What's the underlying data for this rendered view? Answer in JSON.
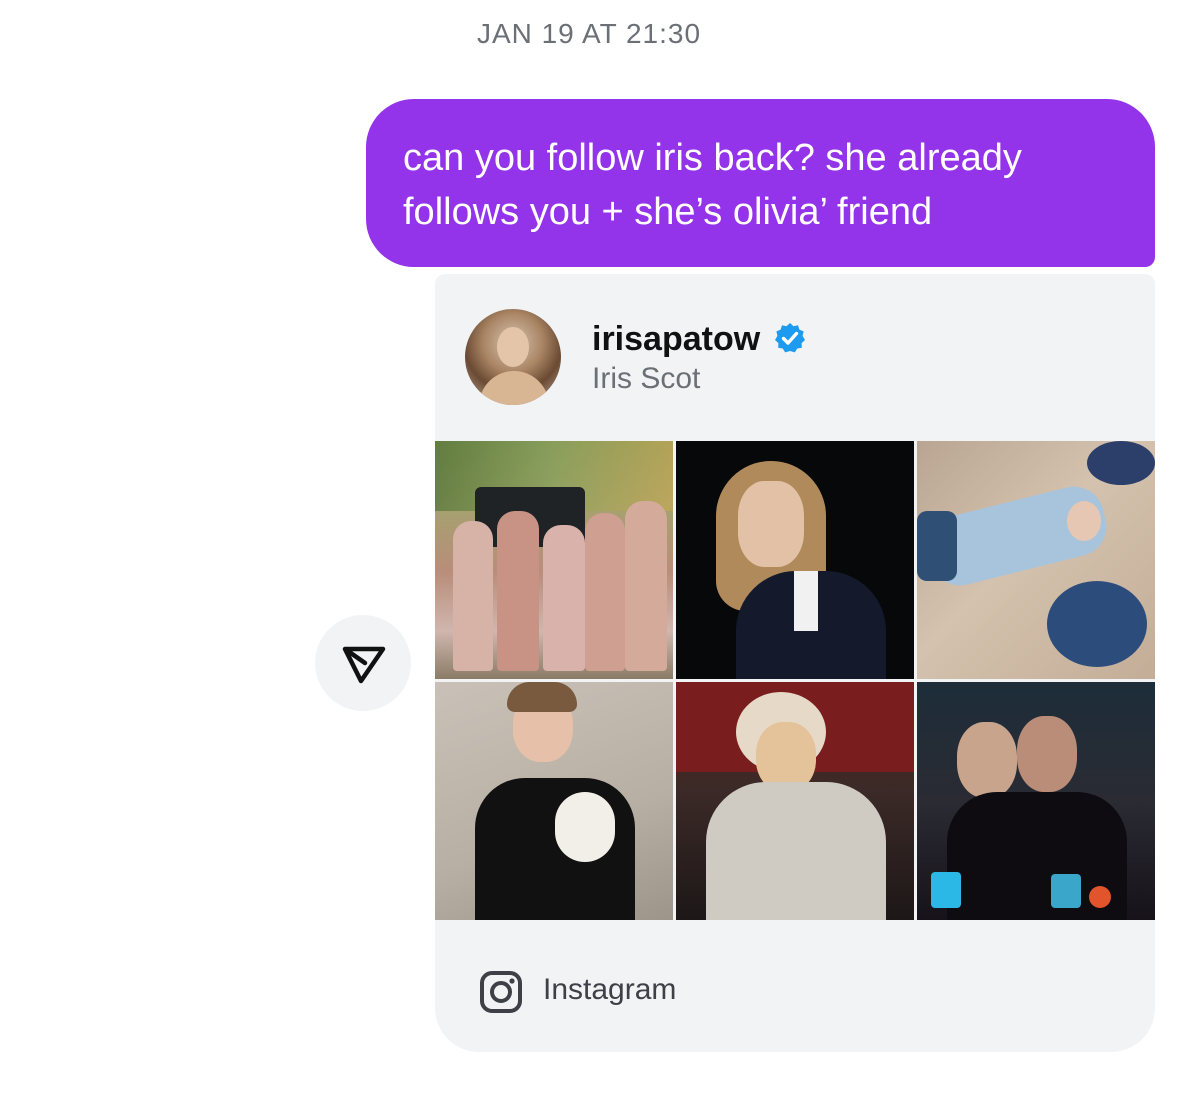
{
  "conversation": {
    "timestamp": "JAN 19 AT 21:30",
    "message": {
      "text": "can you follow iris back? she already follows you + she’s olivia’ friend",
      "bubble_color": "#9333ea"
    }
  },
  "profile_card": {
    "username": "irisapatow",
    "verified": true,
    "verified_icon": "verified-badge-icon",
    "full_name": "Iris Scot",
    "photos": [
      "group-photo",
      "portrait-dark-background",
      "lying-on-floor",
      "black-dress",
      "sequin-top",
      "selfie-at-bar"
    ],
    "footer": {
      "icon": "instagram-icon",
      "label": "Instagram"
    }
  },
  "actions": {
    "share_icon": "share-arrow-icon"
  },
  "colors": {
    "accent": "#9333ea",
    "verified": "#1d9bf0",
    "card_background": "#f2f3f5",
    "secondary_text": "#6b6f76"
  }
}
